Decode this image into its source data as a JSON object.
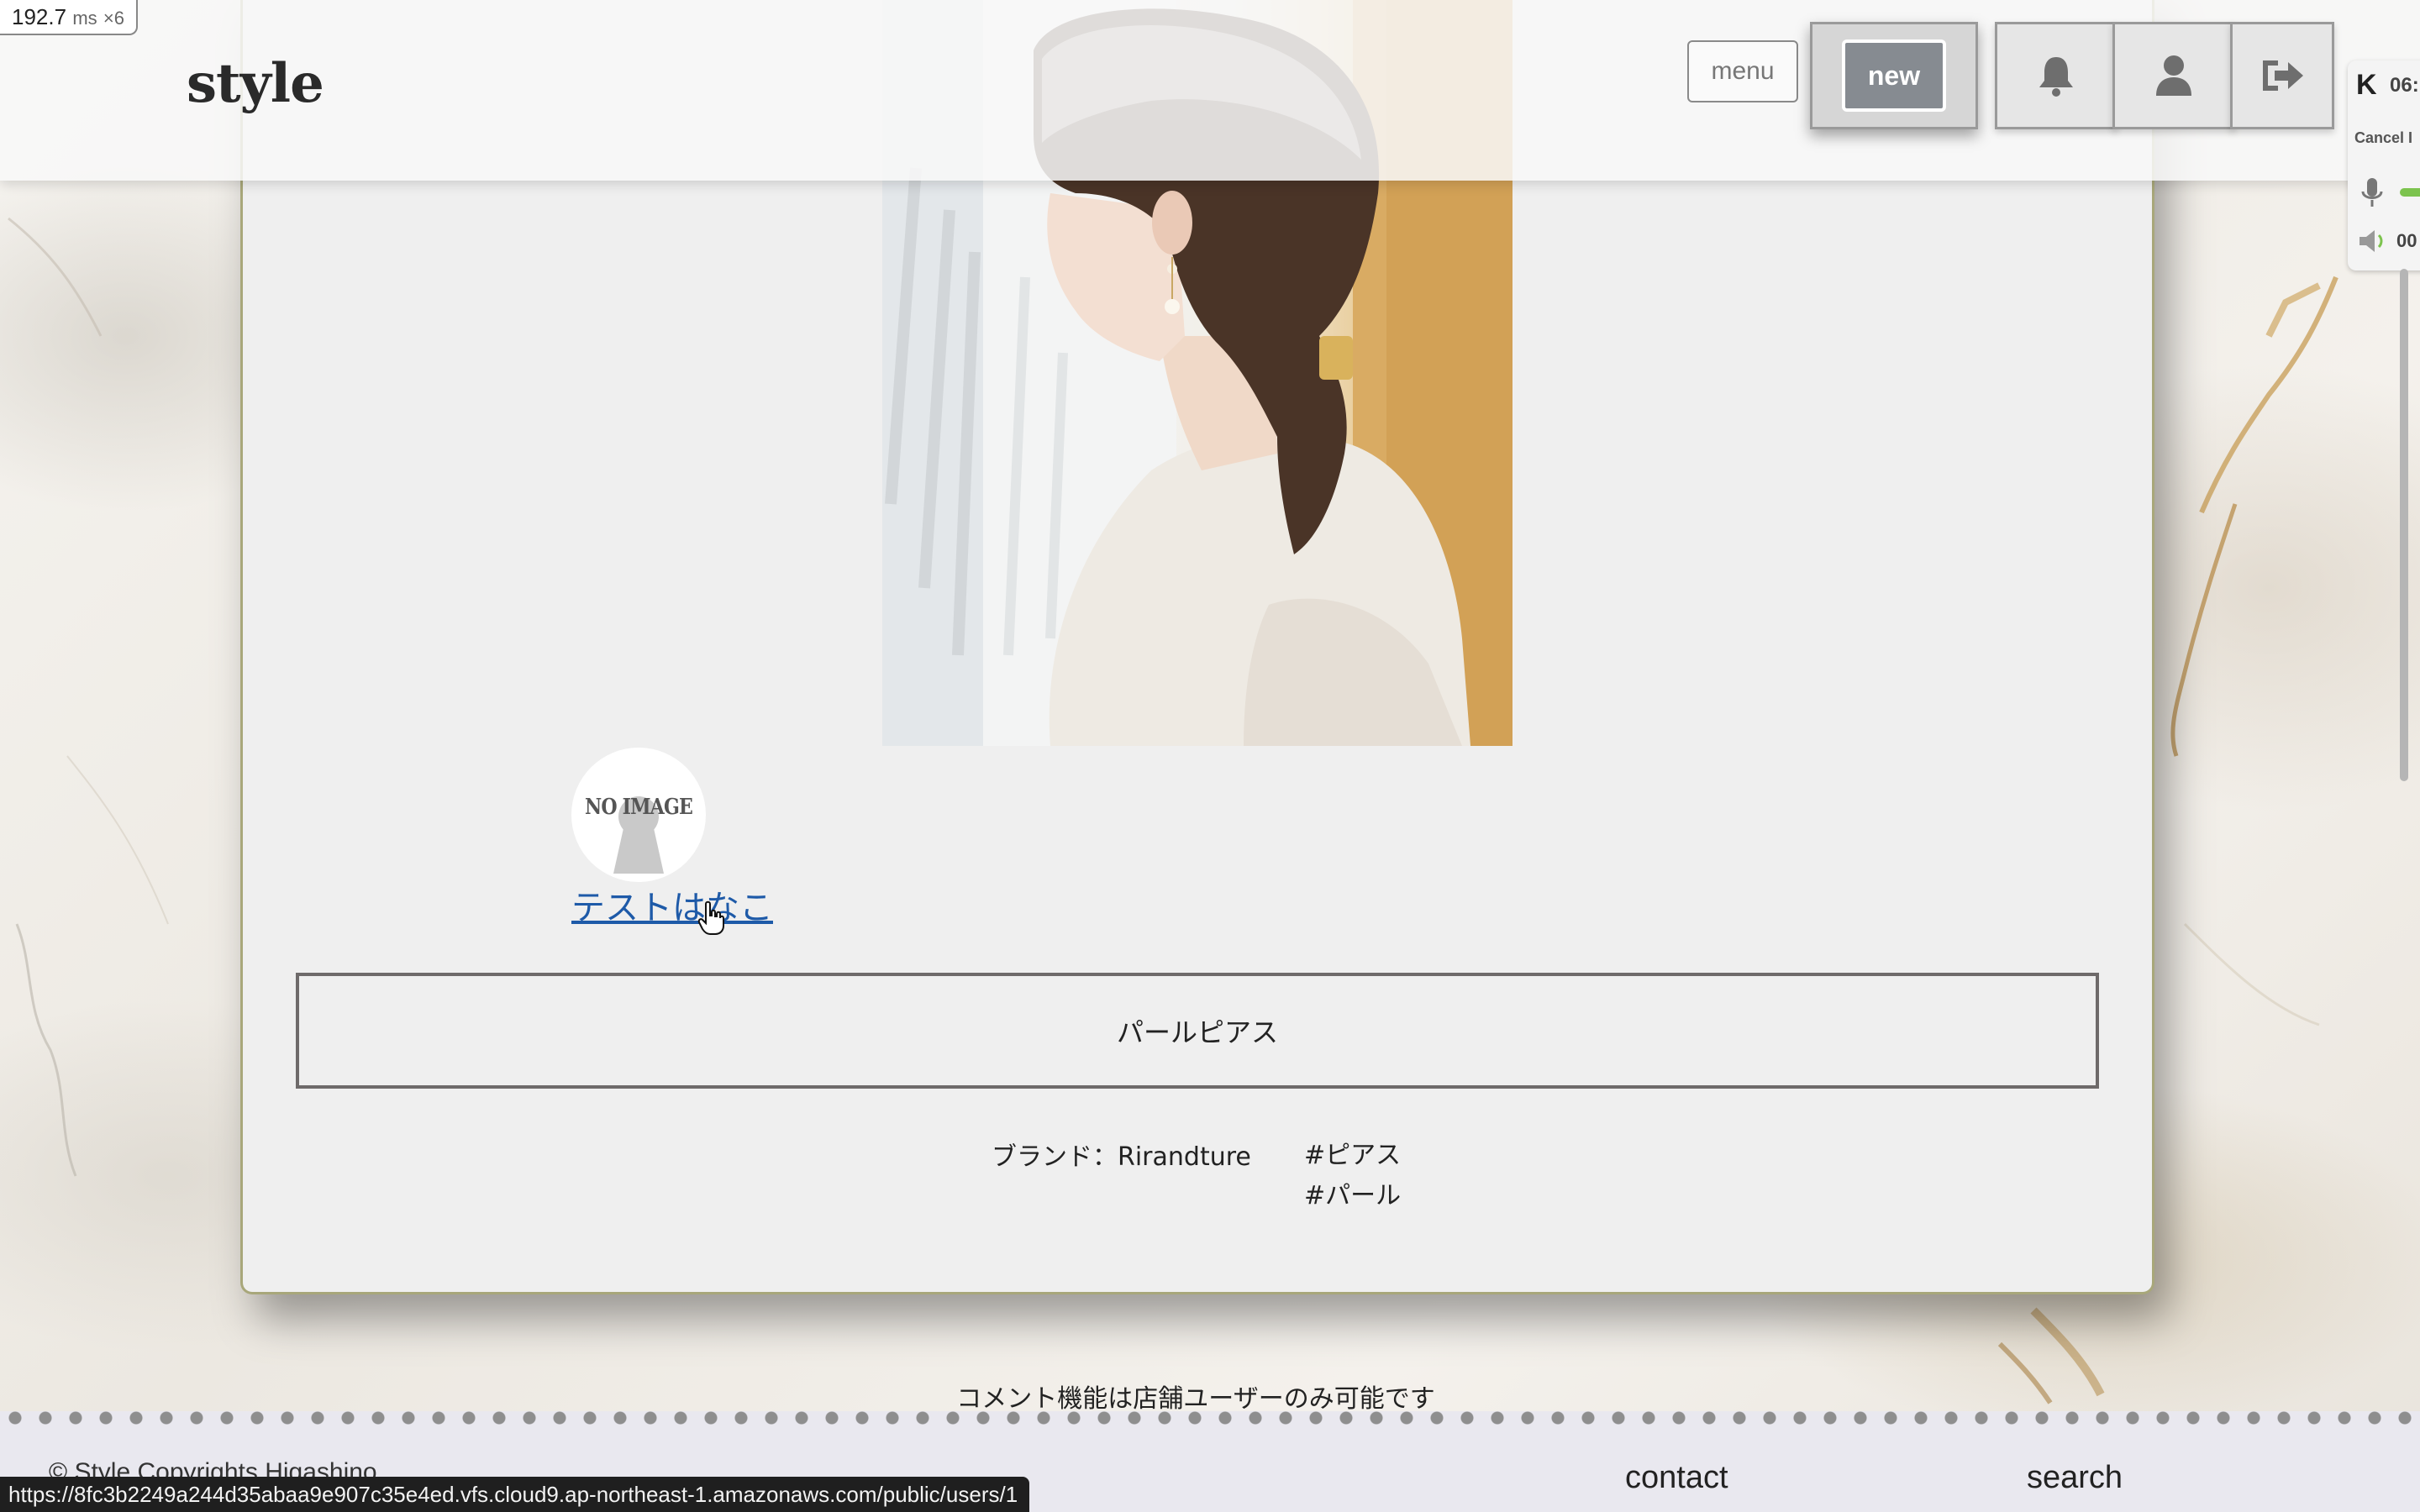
{
  "devtools": {
    "timing_value": "192.7",
    "timing_unit": "ms",
    "timing_mult": "×6"
  },
  "header": {
    "logo": "style",
    "menu_label": "menu",
    "new_label": "new",
    "icons": [
      "bell-icon",
      "user-icon",
      "logout-icon"
    ]
  },
  "extension": {
    "logo_letter": "K",
    "time_top": "06:",
    "cancel_label": "Cancel I",
    "time_bottom": "00"
  },
  "post": {
    "photo_alt": "photo",
    "avatar_text": "NO IMAGE",
    "username": "テストはなこ",
    "title": "パールピアス",
    "brand_label": "ブランド：Rirandture",
    "tags": [
      "#ピアス",
      "#パール"
    ]
  },
  "comment_notice": "コメント機能は店舗ユーザーのみ可能です",
  "footer": {
    "copyright": "© Style Copyrights Higashino",
    "links": [
      "contact",
      "search"
    ]
  },
  "status_bar_url": "https://8fc3b2249a244d35abaa9e907c35e4ed.vfs.cloud9.ap-northeast-1.amazonaws.com/public/users/1",
  "colors": {
    "link": "#1e5aa8",
    "new_button": "#868b91",
    "card_border": "#a8a77a",
    "title_border": "#6e6a6a"
  }
}
